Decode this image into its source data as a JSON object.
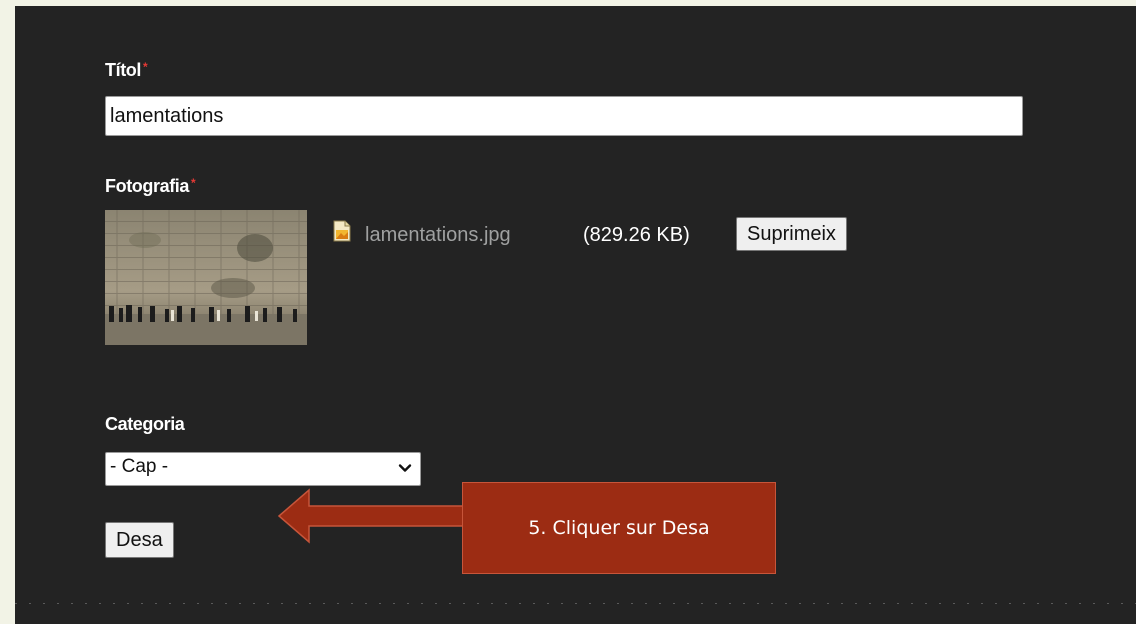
{
  "form": {
    "title_label": "Títol",
    "required_mark": "*",
    "title_value": "lamentations",
    "photo_label": "Fotografia",
    "file_name": "lamentations.jpg",
    "file_size": "(829.26 KB)",
    "delete_button": "Suprimeix",
    "category_label": "Categoria",
    "category_selected": "- Cap -",
    "save_button": "Desa"
  },
  "annotation": {
    "callout_text": "5. Cliquer sur Desa"
  },
  "colors": {
    "page_background": "#f2f3e6",
    "panel_background": "#232323",
    "callout_fill": "#9c2c13",
    "required_mark": "#e53935",
    "file_link": "#9fa0a0"
  },
  "icons": {
    "file": "image-file-icon",
    "dropdown": "chevron-down-icon",
    "pointer": "left-arrow-icon"
  }
}
